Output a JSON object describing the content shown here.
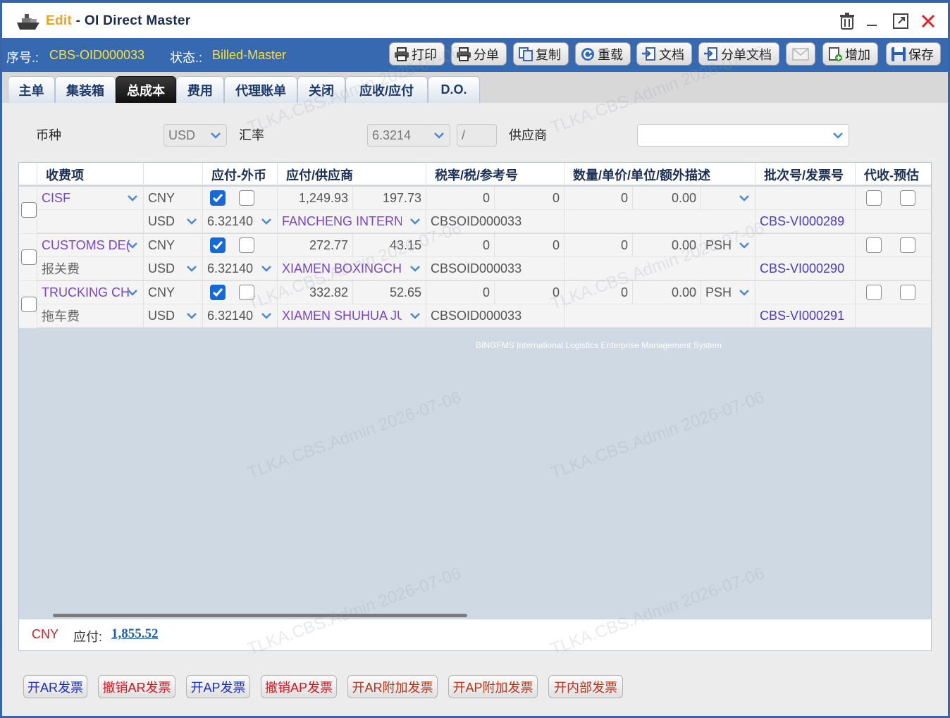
{
  "window": {
    "title_prefix": "Edit",
    "title_sep": " - ",
    "title": "OI Direct Master"
  },
  "status": {
    "serial_label": "序号.:",
    "serial_value": "CBS-OID000033",
    "state_label": "状态.:",
    "state_value": "Billed-Master"
  },
  "toolbar": {
    "print": "打印",
    "split": "分单",
    "copy": "复制",
    "reload": "重载",
    "docs": "文档",
    "split_docs": "分单文档",
    "add": "增加",
    "save": "保存"
  },
  "tabs": [
    "主单",
    "集装箱",
    "总成本",
    "费用",
    "代理账单",
    "关闭",
    "应收/应付",
    "D.O."
  ],
  "active_tab": "总成本",
  "filters": {
    "currency_label": "币种",
    "currency_value": "USD",
    "rate_label": "汇率",
    "rate_value": "6.3214",
    "rate_sep": "/",
    "supplier_label": "供应商",
    "supplier_value": ""
  },
  "grid": {
    "headers": [
      "收费项",
      "应付-外币",
      "应付/供应商",
      "税率/税/参考号",
      "数量/单价/单位/额外描述",
      "批次号/发票号",
      "代收-预估"
    ],
    "rows": [
      {
        "item": "CISF",
        "item_desc": "",
        "cur1": "CNY",
        "cur2": "USD",
        "rate": "6.32140",
        "amount": "1,249.93",
        "foreign": "197.73",
        "supplier": "FANCHENG INTERNAT",
        "tax_rate": "0",
        "tax": "0",
        "ref": "CBSOID000033",
        "qty": "0",
        "price": "0.00",
        "unit": "",
        "invoice": "CBS-VI000289",
        "foreign_checked": true
      },
      {
        "item": "CUSTOMS DE(",
        "item_desc": "报关费",
        "cur1": "CNY",
        "cur2": "USD",
        "rate": "6.32140",
        "amount": "272.77",
        "foreign": "43.15",
        "supplier": "XIAMEN BOXINGCHEI",
        "tax_rate": "0",
        "tax": "0",
        "ref": "CBSOID000033",
        "qty": "0",
        "price": "0.00",
        "unit": "PSH",
        "invoice": "CBS-VI000290",
        "foreign_checked": true
      },
      {
        "item": "TRUCKING CH",
        "item_desc": "拖车费",
        "cur1": "CNY",
        "cur2": "USD",
        "rate": "6.32140",
        "amount": "332.82",
        "foreign": "52.65",
        "supplier": "XIAMEN SHUHUA JUF",
        "tax_rate": "0",
        "tax": "0",
        "ref": "CBSOID000033",
        "qty": "0",
        "price": "0.00",
        "unit": "PSH",
        "invoice": "CBS-VI000291",
        "foreign_checked": true
      }
    ],
    "system_caption": "BINGFMS International Logistics Enterprise Management System"
  },
  "totals": {
    "currency": "CNY",
    "payable_label": "应付:",
    "payable_value": "1,855.52"
  },
  "bottom_buttons": [
    {
      "label": "开AR发票",
      "color": "#1a2fc4"
    },
    {
      "label": "撤销AR发票",
      "color": "#d4161e"
    },
    {
      "label": "开AP发票",
      "color": "#1a2fc4"
    },
    {
      "label": "撤销AP发票",
      "color": "#d4161e"
    },
    {
      "label": "开AR附加发票",
      "color": "#b8361a"
    },
    {
      "label": "开AP附加发票",
      "color": "#b8361a"
    },
    {
      "label": "开内部发票",
      "color": "#b8361a"
    }
  ],
  "watermark": "TLKA.CBS.Admin 2026-07-06",
  "colors": {
    "accent_blue": "#3769b0",
    "highlight_yellow": "#ffe326",
    "close_red": "#e02020",
    "checkbox_blue": "#1769d8",
    "link_purple": "#7a45c3"
  }
}
